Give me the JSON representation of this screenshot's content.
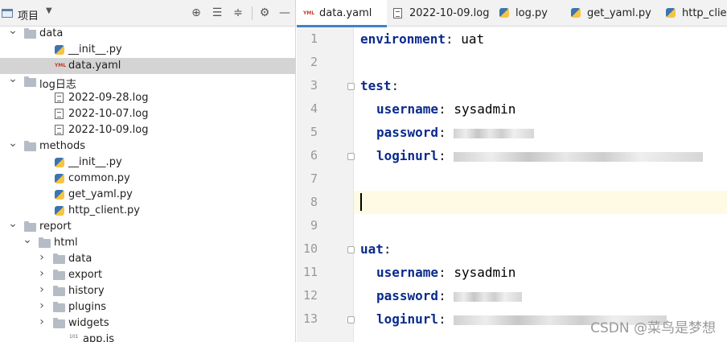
{
  "project_panel": {
    "title": "项目",
    "toolbar_icons": [
      "locate-icon",
      "expand-all-icon",
      "collapse-all-icon",
      "gear-icon",
      "minimize-icon"
    ]
  },
  "tree": [
    {
      "label": "data",
      "type": "folder",
      "expanded": true
    },
    {
      "label": "__init__.py",
      "type": "py"
    },
    {
      "label": "data.yaml",
      "type": "yaml",
      "selected": true
    },
    {
      "label": "log日志",
      "type": "folder",
      "expanded": true
    },
    {
      "label": "2022-09-28.log",
      "type": "log"
    },
    {
      "label": "2022-10-07.log",
      "type": "log"
    },
    {
      "label": "2022-10-09.log",
      "type": "log"
    },
    {
      "label": "methods",
      "type": "folder",
      "expanded": true
    },
    {
      "label": "__init__.py",
      "type": "py"
    },
    {
      "label": "common.py",
      "type": "py"
    },
    {
      "label": "get_yaml.py",
      "type": "py"
    },
    {
      "label": "http_client.py",
      "type": "py"
    },
    {
      "label": "report",
      "type": "folder",
      "expanded": true
    },
    {
      "label": "html",
      "type": "folder",
      "expanded": true
    },
    {
      "label": "data",
      "type": "folder",
      "expanded": false
    },
    {
      "label": "export",
      "type": "folder",
      "expanded": false
    },
    {
      "label": "history",
      "type": "folder",
      "expanded": false
    },
    {
      "label": "plugins",
      "type": "folder",
      "expanded": false
    },
    {
      "label": "widgets",
      "type": "folder",
      "expanded": false
    },
    {
      "label": "app.js",
      "type": "js"
    }
  ],
  "tabs": [
    {
      "label": "data.yaml",
      "type": "yaml",
      "active": true
    },
    {
      "label": "2022-10-09.log",
      "type": "log"
    },
    {
      "label": "log.py",
      "type": "py"
    },
    {
      "label": "get_yaml.py",
      "type": "py"
    },
    {
      "label": "http_client",
      "type": "py"
    }
  ],
  "editor": {
    "current_line": 8,
    "lines": [
      {
        "n": "1",
        "key": "environment",
        "value": "uat"
      },
      {
        "n": "2"
      },
      {
        "n": "3",
        "key": "test",
        "value": ""
      },
      {
        "n": "4",
        "key": "username",
        "value": "sysadmin",
        "indent": true
      },
      {
        "n": "5",
        "key": "password",
        "value": "",
        "redacted": true,
        "indent": true
      },
      {
        "n": "6",
        "key": "loginurl",
        "value": "",
        "redacted": true,
        "indent": true
      },
      {
        "n": "7"
      },
      {
        "n": "8"
      },
      {
        "n": "9"
      },
      {
        "n": "10",
        "key": "uat",
        "value": ""
      },
      {
        "n": "11",
        "key": "username",
        "value": "sysadmin",
        "indent": true
      },
      {
        "n": "12",
        "key": "password",
        "value": "",
        "redacted": true,
        "indent": true
      },
      {
        "n": "13",
        "key": "loginurl",
        "value": "",
        "redacted": true,
        "indent": true
      }
    ]
  },
  "watermark": "CSDN @菜鸟是梦想",
  "colors": {
    "accent": "#4083c9",
    "key": "#0a2a8c",
    "current_line": "#fffae3",
    "selected_row": "#d4d4d4"
  }
}
